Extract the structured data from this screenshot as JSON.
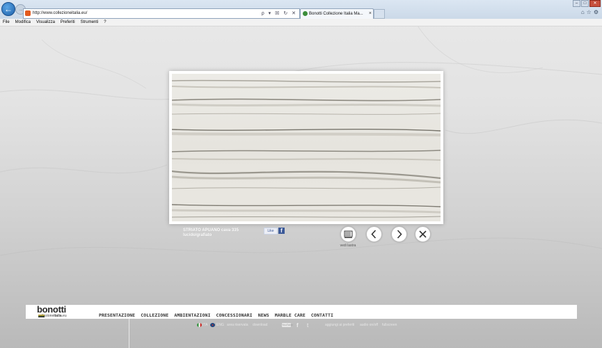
{
  "browser": {
    "url": "http://www.collezioneitalia.eu/",
    "tab_title": "Bonotti Collezione Italia Ma...",
    "address_tools": "ρ ▾ ☒ ↻ ✕",
    "menu": [
      "File",
      "Modifica",
      "Visualizza",
      "Preferiti",
      "Strumenti",
      "?"
    ]
  },
  "lightbox": {
    "caption_line1": "STRIATO APUANO cava 335",
    "caption_line2": "lucido/grafiato",
    "like_label": "Like",
    "fb_glyph": "f",
    "vedi_label": "vedi lastra"
  },
  "site": {
    "logo_main": "bonotti",
    "logo_sub_a": "collezione",
    "logo_sub_b": "italia",
    "logo_sub_c": ".eu",
    "nav": [
      "PRESENTAZIONE",
      "COLLEZIONE",
      "AMBIENTAZIONI",
      "CONCESSIONARI",
      "NEWS",
      "MARBLE CARE",
      "CONTATTI"
    ]
  },
  "utility": {
    "lang_it": "ITA",
    "lang_en": "ENG",
    "area_riservata": "area riservata",
    "download": "download",
    "youtube": "YouTube",
    "aggiungi": "aggiungi ai preferiti",
    "audio": "audio on/off",
    "fullscreen": "fullscreen"
  },
  "colors": {
    "accent": "#1d5fa8",
    "facebook": "#3b5998"
  }
}
